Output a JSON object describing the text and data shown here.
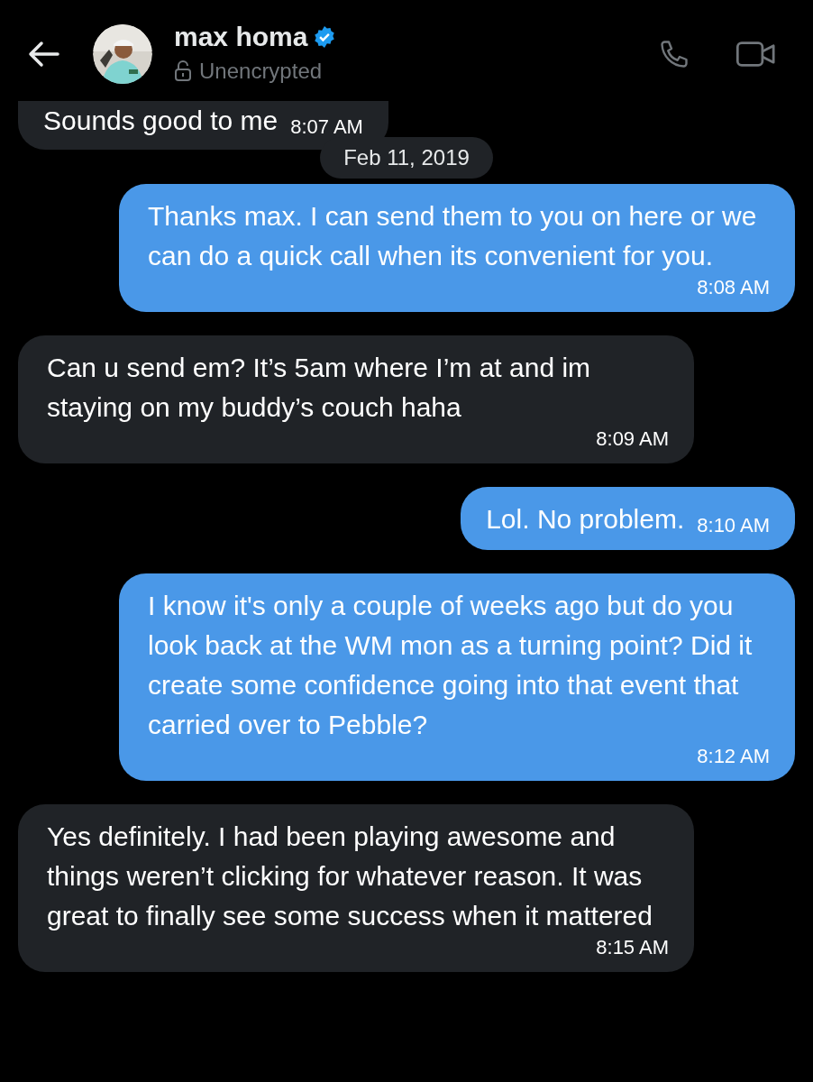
{
  "header": {
    "name": "max homa",
    "verified": true,
    "status": "Unencrypted"
  },
  "messages": [
    {
      "kind": "incoming",
      "text": "Sounds good to me",
      "time": "8:07 AM"
    },
    {
      "kind": "date",
      "text": "Feb 11, 2019"
    },
    {
      "kind": "outgoing",
      "text": "Thanks max. I can send them to you on here or we can do a quick call when its convenient for you.",
      "time": "8:08 AM"
    },
    {
      "kind": "incoming",
      "text": "Can u send em? It’s 5am where I’m at and im staying on my buddy’s couch haha",
      "time": "8:09 AM"
    },
    {
      "kind": "outgoing",
      "text": "Lol. No problem.",
      "time": "8:10 AM"
    },
    {
      "kind": "outgoing",
      "text": "I know it's only a couple of weeks ago but do you look back at the WM mon as a turning point? Did it create some confidence going into that event that carried over to Pebble?",
      "time": "8:12 AM"
    },
    {
      "kind": "incoming",
      "text": "Yes definitely. I had been playing awesome and things weren’t clicking for whatever reason. It was great to finally see some success when it mattered",
      "time": "8:15 AM"
    }
  ]
}
